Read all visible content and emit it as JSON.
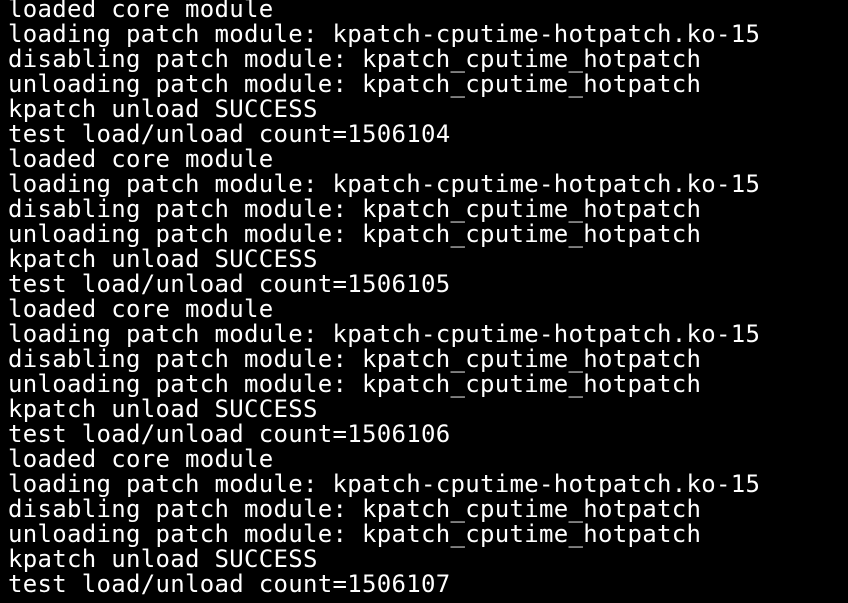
{
  "terminal": {
    "lines": [
      "loaded core module",
      "loading patch module: kpatch-cputime-hotpatch.ko-15",
      "disabling patch module: kpatch_cputime_hotpatch",
      "unloading patch module: kpatch_cputime_hotpatch",
      "kpatch unload SUCCESS",
      "test load/unload count=1506104",
      "loaded core module",
      "loading patch module: kpatch-cputime-hotpatch.ko-15",
      "disabling patch module: kpatch_cputime_hotpatch",
      "unloading patch module: kpatch_cputime_hotpatch",
      "kpatch unload SUCCESS",
      "test load/unload count=1506105",
      "loaded core module",
      "loading patch module: kpatch-cputime-hotpatch.ko-15",
      "disabling patch module: kpatch_cputime_hotpatch",
      "unloading patch module: kpatch_cputime_hotpatch",
      "kpatch unload SUCCESS",
      "test load/unload count=1506106",
      "loaded core module",
      "loading patch module: kpatch-cputime-hotpatch.ko-15",
      "disabling patch module: kpatch_cputime_hotpatch",
      "unloading patch module: kpatch_cputime_hotpatch",
      "kpatch unload SUCCESS",
      "test load/unload count=1506107"
    ]
  },
  "colors": {
    "background": "#000000",
    "foreground": "#ffffff"
  }
}
